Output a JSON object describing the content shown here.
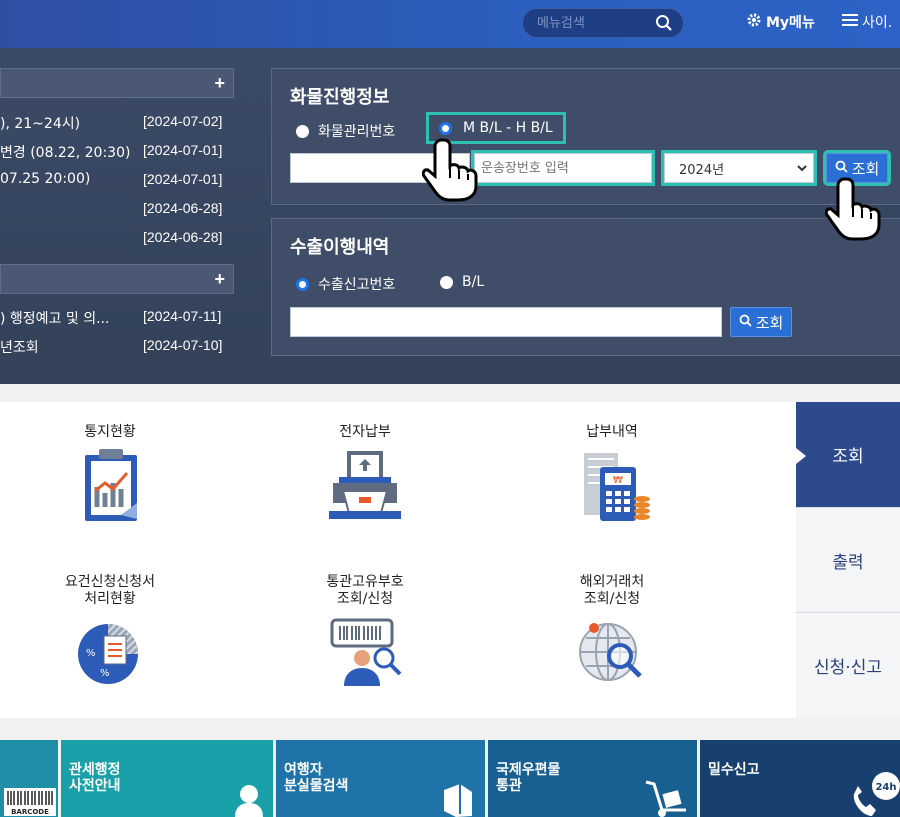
{
  "topbar": {
    "menu_search_placeholder": "메뉴검색",
    "mymenu_label": "My메뉴",
    "sitemap_label": "사이."
  },
  "notices_top": {
    "plus": "+",
    "rows": [
      {
        "title": "), 21~24시)",
        "date": "[2024-07-02]"
      },
      {
        "title": "변경 (08.22, 20:30)",
        "date": "[2024-07-01]"
      },
      {
        "title": "07.25 20:00)",
        "date": "[2024-07-01]"
      },
      {
        "title": "",
        "date": "[2024-06-28]"
      },
      {
        "title": "",
        "date": "[2024-06-28]"
      }
    ]
  },
  "notices_bottom": {
    "plus": "+",
    "rows": [
      {
        "title": ") 행정예고 및 의...",
        "date": "[2024-07-11]"
      },
      {
        "title": "년조회",
        "date": "[2024-07-10]"
      }
    ]
  },
  "cargo": {
    "title": "화물진행정보",
    "radio1": "화물관리번호",
    "radio2": "M B/L - H B/L",
    "input2_placeholder": "운송장번호 입력",
    "year_selected": "2024년",
    "search_label": "조회"
  },
  "export": {
    "title": "수출이행내역",
    "radio1": "수출신고번호",
    "radio2": "B/L",
    "search_label": "조회"
  },
  "quick_items": [
    {
      "label": "통지현황",
      "icon": "report-chart-icon"
    },
    {
      "label": "전자납부",
      "icon": "electronic-payment-icon"
    },
    {
      "label": "납부내역",
      "icon": "payment-history-icon"
    },
    {
      "label": "요건신청신청서\n처리현황",
      "icon": "pie-document-icon"
    },
    {
      "label": "통관고유부호\n조회/신청",
      "icon": "barcode-person-icon"
    },
    {
      "label": "해외거래처\n조회/신청",
      "icon": "globe-search-icon"
    }
  ],
  "side_tabs": [
    "조회",
    "출력",
    "신청·신고"
  ],
  "tiles": [
    {
      "label": "",
      "sub": "BARCODE",
      "color": "#1e8fa6"
    },
    {
      "label": "관세행정\n사전안내",
      "color": "#1aa0a8"
    },
    {
      "label": "여행자\n분실물검색",
      "color": "#1f73a8"
    },
    {
      "label": "국제우편물\n통관",
      "color": "#185f92"
    },
    {
      "label": "밀수신고",
      "badge": "24h",
      "color": "#17406f"
    }
  ]
}
